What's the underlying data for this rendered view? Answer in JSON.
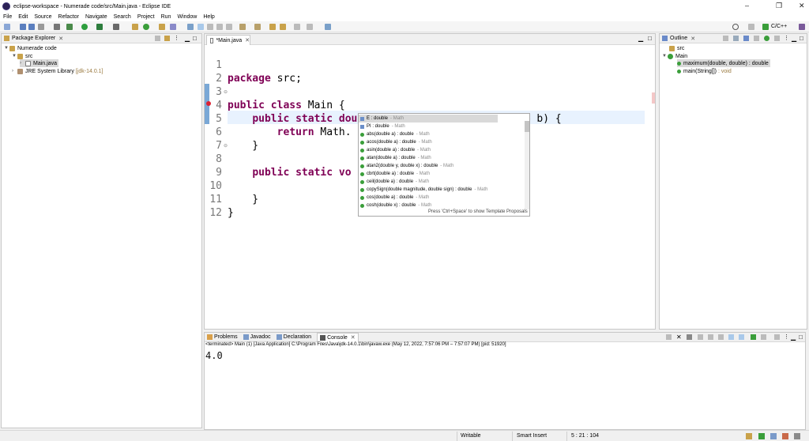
{
  "window": {
    "title": "eclipse-workspace - Numerade code/src/Main.java - Eclipse IDE",
    "controls": [
      "–",
      "❐",
      "✕"
    ]
  },
  "menu": [
    "File",
    "Edit",
    "Source",
    "Refactor",
    "Navigate",
    "Search",
    "Project",
    "Run",
    "Window",
    "Help"
  ],
  "perspective": {
    "label": "C/C++"
  },
  "package_explorer": {
    "tab_label": "Package Explorer",
    "tree": [
      {
        "label": "Numerade code",
        "icon": "project-icon"
      },
      {
        "label": "src",
        "icon": "package-folder-icon"
      },
      {
        "label": "Main.java",
        "icon": "java-file-icon",
        "selected": true
      },
      {
        "label": "JRE System Library",
        "suffix": "[jdk-14.0.1]",
        "icon": "library-icon"
      }
    ]
  },
  "editor": {
    "tab_label": "*Main.java",
    "lines": [
      {
        "n": "1",
        "text": "package src;"
      },
      {
        "n": "2",
        "text": ""
      },
      {
        "n": "3",
        "text": "public class Main {"
      },
      {
        "n": "4",
        "text": "    public static double maximum(double a, double b) {"
      },
      {
        "n": "5",
        "text": "        return Math."
      },
      {
        "n": "6",
        "text": "    }"
      },
      {
        "n": "7",
        "text": ""
      },
      {
        "n": "8",
        "text": "    public static vo"
      },
      {
        "n": "9",
        "text": ""
      },
      {
        "n": "10",
        "text": "    }"
      },
      {
        "n": "11",
        "text": "}"
      },
      {
        "n": "12",
        "text": ""
      }
    ]
  },
  "autocomplete": {
    "items": [
      {
        "name": "E : double",
        "decl": "- Math",
        "kind": "field"
      },
      {
        "name": "PI : double",
        "decl": "- Math",
        "kind": "field"
      },
      {
        "name": "abs(double a) : double",
        "decl": "- Math",
        "kind": "method"
      },
      {
        "name": "acos(double a) : double",
        "decl": "- Math",
        "kind": "method"
      },
      {
        "name": "asin(double a) : double",
        "decl": "- Math",
        "kind": "method"
      },
      {
        "name": "atan(double a) : double",
        "decl": "- Math",
        "kind": "method"
      },
      {
        "name": "atan2(double y, double x) : double",
        "decl": "- Math",
        "kind": "method"
      },
      {
        "name": "cbrt(double a) : double",
        "decl": "- Math",
        "kind": "method"
      },
      {
        "name": "ceil(double a) : double",
        "decl": "- Math",
        "kind": "method"
      },
      {
        "name": "copySign(double magnitude, double sign) : double",
        "decl": "- Math",
        "kind": "method"
      },
      {
        "name": "cos(double a) : double",
        "decl": "- Math",
        "kind": "method"
      },
      {
        "name": "cosh(double x) : double",
        "decl": "- Math",
        "kind": "method"
      }
    ],
    "footer": "Press 'Ctrl+Space' to show Template Proposals"
  },
  "outline": {
    "tab_label": "Outline",
    "tree": [
      {
        "label": "src",
        "icon": "package-icon"
      },
      {
        "label": "Main",
        "icon": "class-icon"
      },
      {
        "label": "maximum(double, double) : double",
        "icon": "method-icon",
        "selected": true
      },
      {
        "label": "main(String[])",
        "suffix": ": void",
        "icon": "method-icon"
      }
    ]
  },
  "console": {
    "tabs": [
      "Problems",
      "Javadoc",
      "Declaration",
      "Console"
    ],
    "terminated": "<terminated> Main (1) [Java Application] C:\\Program Files\\Java\\jdk-14.0.1\\bin\\javaw.exe  (May 12, 2022, 7:57:06 PM – 7:57:07 PM) [pid: 51920]",
    "output": "4.0"
  },
  "status": {
    "writable": "Writable",
    "insert_mode": "Smart Insert",
    "position": "5 : 21 : 104"
  },
  "colors": {
    "keyword": "#7f0055",
    "current_line": "#e8f2fe",
    "selection": "#d9d9d9"
  }
}
